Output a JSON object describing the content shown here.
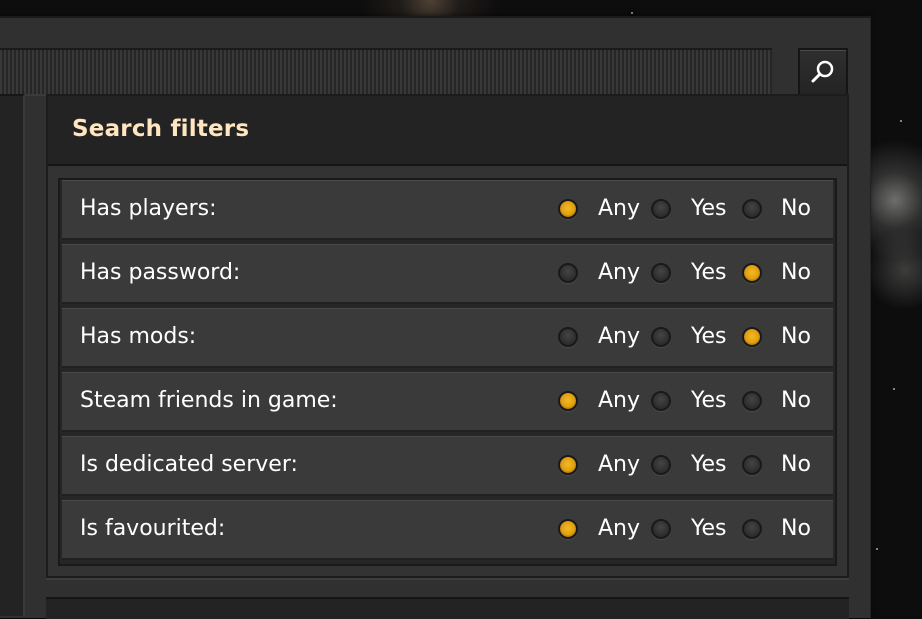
{
  "search": {
    "icon": "magnifier-icon"
  },
  "filters": {
    "title": "Search filters",
    "options": {
      "any": "Any",
      "yes": "Yes",
      "no": "No"
    },
    "rows": [
      {
        "label": "Has players:",
        "selected": "any"
      },
      {
        "label": "Has password:",
        "selected": "no"
      },
      {
        "label": "Has mods:",
        "selected": "no"
      },
      {
        "label": "Steam friends in game:",
        "selected": "any"
      },
      {
        "label": "Is dedicated server:",
        "selected": "any"
      },
      {
        "label": "Is favourited:",
        "selected": "any"
      }
    ]
  },
  "colors": {
    "title": "#ffe6c0",
    "radio_checked": "#e0a010",
    "panel": "#333333",
    "row": "#3a3a3a"
  }
}
